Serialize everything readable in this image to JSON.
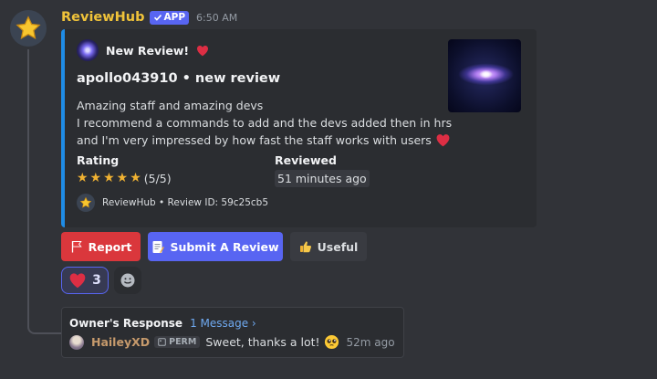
{
  "message": {
    "username": "ReviewHub",
    "app_tag": "APP",
    "timestamp": "6:50 AM"
  },
  "embed": {
    "accent_color": "#1f8ce6",
    "author": {
      "name": "New Review!",
      "emoji": "heart-emoji"
    },
    "title": "apollo043910 • new review",
    "description_lines": [
      "Amazing staff and amazing devs",
      "I recommend a commands to add and the devs added then in hrs",
      "and I'm very impressed by how fast the staff works with users"
    ],
    "fields": {
      "rating": {
        "name": "Rating",
        "stars": "★★★★★",
        "score_text": "(5/5)",
        "stars_filled": 5,
        "stars_total": 5
      },
      "reviewed": {
        "name": "Reviewed",
        "value": "51 minutes ago"
      }
    },
    "footer": "ReviewHub • Review ID: 59c25cb5"
  },
  "buttons": {
    "report": "Report",
    "submit": "Submit A Review",
    "useful": "Useful"
  },
  "reactions": [
    {
      "emoji": "heart-emoji",
      "count": "3",
      "selected": true
    }
  ],
  "response": {
    "title": "Owner's Response",
    "link": "1 Message ›",
    "user": "HaileyXD",
    "tag": "PERM",
    "message": "Sweet, thanks a lot!",
    "time": "52m ago"
  },
  "colors": {
    "background": "#313338",
    "embed_background": "#2b2d31",
    "username": "#f0c33a",
    "report_button": "#da373c",
    "submit_button": "#5865f2",
    "useful_button": "#393b41",
    "link": "#6fa9f0"
  }
}
